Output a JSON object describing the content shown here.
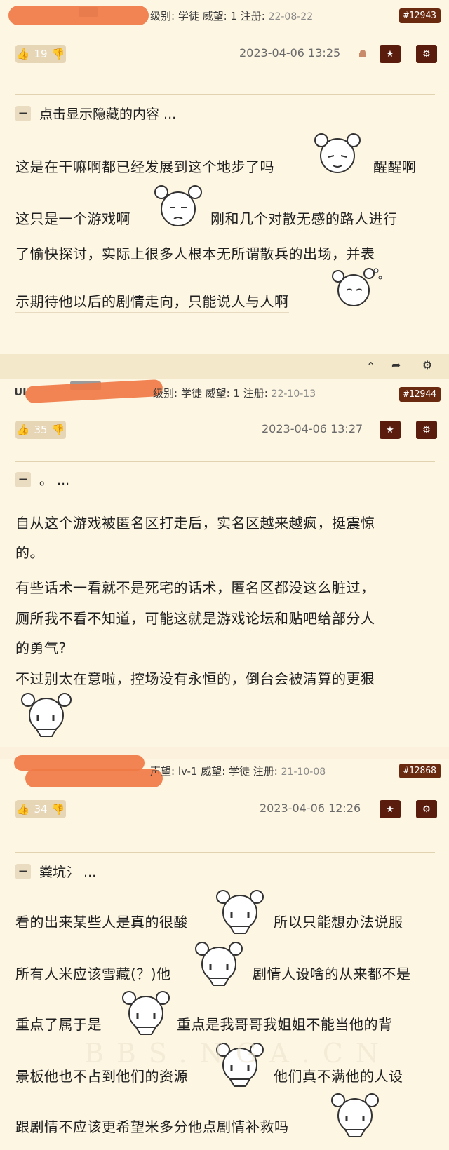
{
  "posts": [
    {
      "user_meta": "级别: 学徒 威望: 1 注册:",
      "reg_date": "22-08-22",
      "post_id": "#12943",
      "votes": "19",
      "timestamp": "2023-04-06 13:25",
      "toggle_label": "点击显示隐藏的内容 ...",
      "lines": [
        "这是在干嘛啊都已经发展到这个地步了吗",
        "醒醒啊",
        "这只是一个游戏啊",
        "刚和几个对散无感的路人进行",
        "了愉快探讨，实际上很多人根本无所谓散兵的出场，并表",
        "示期待他以后的剧情走向，只能说人与人啊"
      ]
    },
    {
      "user_prefix": "UI",
      "user_meta": "级别: 学徒 威望: 1 注册:",
      "reg_date": "22-10-13",
      "post_id": "#12944",
      "votes": "35",
      "timestamp": "2023-04-06 13:27",
      "toggle_label": "。 ...",
      "lines": [
        "自从这个游戏被匿名区打走后，实名区越来越疯，挺震惊",
        "的。",
        "有些话术一看就不是死宅的话术，匿名区都没这么脏过，",
        "厕所我不看不知道，可能这就是游戏论坛和贴吧给部分人",
        "的勇气?",
        "不过别太在意啦，控场没有永恒的，倒台会被清算的更狠"
      ]
    },
    {
      "user_meta": "声望: lv-1 威望: 学徒 注册:",
      "reg_date": "21-10-08",
      "post_id": "#12868",
      "votes": "34",
      "timestamp": "2023-04-06 12:26",
      "toggle_label": "粪坑氵 ...",
      "lines": [
        "看的出来某些人是真的很酸",
        "所以只能想办法说服",
        "所有人米应该雪藏(？)他",
        "剧情人设啥的从来都不是",
        "重点了属于是",
        "重点是我哥哥我姐姐不能当他的背",
        "景板他也不占到他们的资源",
        "他们真不满他的人设",
        "跟剧情不应该更希望米多分他点剧情补救吗"
      ]
    }
  ],
  "watermark": "BBS.NGA.CN",
  "icons": [
    "thumb-up-icon",
    "thumb-down-icon",
    "android-icon",
    "star-icon",
    "gear-icon",
    "chevron-up-icon",
    "share-icon"
  ]
}
